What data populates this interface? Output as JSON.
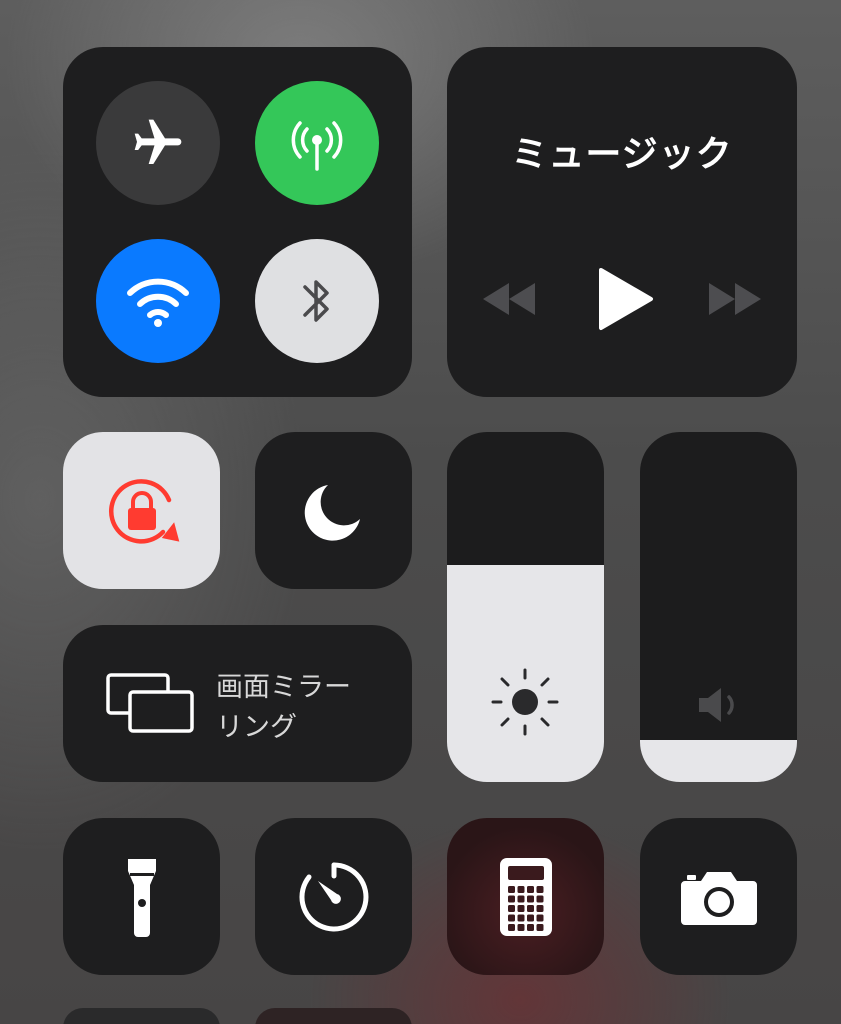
{
  "connectivity": {
    "airplane": {
      "icon": "airplane-icon",
      "active": false,
      "color": "#3a3a3b"
    },
    "cellular": {
      "icon": "cellular-antenna-icon",
      "active": true,
      "color": "#34c759"
    },
    "wifi": {
      "icon": "wifi-icon",
      "active": true,
      "color": "#0a7aff"
    },
    "bluetooth": {
      "icon": "bluetooth-icon",
      "active": true,
      "color": "#dfe0e2"
    }
  },
  "music": {
    "title": "ミュージック",
    "controls": [
      "rewind-icon",
      "play-icon",
      "fast-forward-icon"
    ]
  },
  "orientation_lock": {
    "icon": "orientation-lock-icon",
    "active": true,
    "accent": "#ff3b30"
  },
  "do_not_disturb": {
    "icon": "moon-icon",
    "active": false
  },
  "screen_mirroring": {
    "label_line1": "画面ミラー",
    "label_line2": "リング",
    "icon": "screen-mirroring-icon"
  },
  "brightness": {
    "icon": "sun-icon",
    "level": 0.62
  },
  "volume": {
    "icon": "speaker-icon",
    "level": 0.12
  },
  "shortcuts": [
    {
      "name": "flashlight",
      "icon": "flashlight-icon"
    },
    {
      "name": "timer",
      "icon": "timer-icon"
    },
    {
      "name": "calculator",
      "icon": "calculator-icon"
    },
    {
      "name": "camera",
      "icon": "camera-icon"
    }
  ]
}
